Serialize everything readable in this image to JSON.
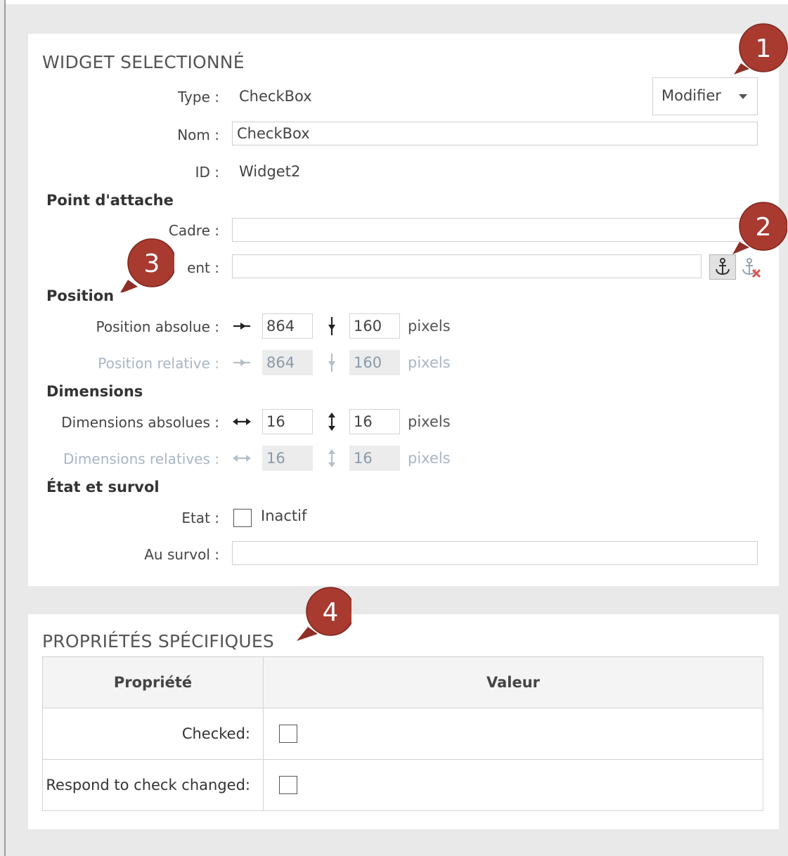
{
  "widget_panel": {
    "title": "WIDGET SELECTIONNÉ",
    "type_label": "Type :",
    "type_value": "CheckBox",
    "modify_label": "Modifier",
    "name_label": "Nom :",
    "name_value": "CheckBox",
    "id_label": "ID :",
    "id_value": "Widget2",
    "anchor_group": "Point d'attache",
    "frame_label": "Cadre :",
    "frame_value": "",
    "element_label": "ent :",
    "element_value": "",
    "position_group": "Position",
    "abs_pos_label": "Position absolue :",
    "abs_pos_x": "864",
    "abs_pos_y": "160",
    "rel_pos_label": "Position relative :",
    "rel_pos_x": "864",
    "rel_pos_y": "160",
    "dim_group": "Dimensions",
    "abs_dim_label": "Dimensions absolues :",
    "abs_dim_w": "16",
    "abs_dim_h": "16",
    "rel_dim_label": "Dimensions relatives :",
    "rel_dim_w": "16",
    "rel_dim_h": "16",
    "unit": "pixels",
    "state_group": "État et survol",
    "state_label": "Etat :",
    "state_checkbox_label": "Inactif",
    "hover_label": "Au survol :",
    "hover_value": ""
  },
  "props_panel": {
    "title": "PROPRIÉTÉS SPÉCIFIQUES",
    "col_property": "Propriété",
    "col_value": "Valeur",
    "rows": [
      {
        "name": "Checked:",
        "checked": false
      },
      {
        "name": "Respond to check changed:",
        "checked": false
      }
    ]
  },
  "callouts": [
    "1",
    "2",
    "3",
    "4"
  ],
  "colors": {
    "callout_fill": "#a83a30",
    "panel_bg": "#ffffff",
    "page_bg": "#e9e9e9",
    "dim_text": "#a9b6c4"
  },
  "icons": [
    "dropdown-arrow-icon",
    "anchor-icon",
    "remove-anchor-icon",
    "arrow-right-icon",
    "arrow-down-icon",
    "double-arrow-horizontal-icon",
    "double-arrow-vertical-icon"
  ]
}
